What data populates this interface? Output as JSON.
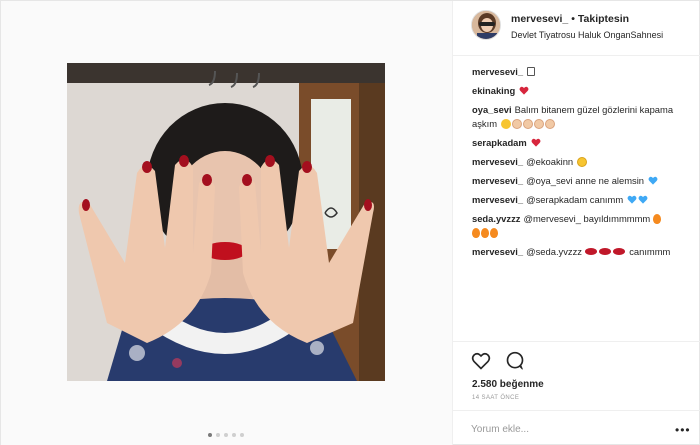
{
  "post": {
    "username": "mervesevi_",
    "separator": "•",
    "follow_status": "Takiptesin",
    "location": "Devlet Tiyatrosu Haluk OnganSahnesi",
    "carousel_count": 5,
    "carousel_active": 1
  },
  "comments": [
    {
      "user": "mervesevi_",
      "text": "",
      "emoji": "white-square"
    },
    {
      "user": "ekinaking",
      "text": "",
      "emoji": "red-heart"
    },
    {
      "user": "oya_sevi",
      "text": "Balım bitanem güzel gözlerini kapama aşkım",
      "emoji": "smile-faces"
    },
    {
      "user": "serapkadam",
      "text": "",
      "emoji": "red-heart"
    },
    {
      "user": "mervesevi_",
      "text": "@ekoakinn",
      "emoji": "laughing-face"
    },
    {
      "user": "mervesevi_",
      "text": "@oya_sevi anne ne alemsin",
      "emoji": "blue-heart"
    },
    {
      "user": "mervesevi_",
      "text": "@serapkadam canımm",
      "emoji": "blue-hearts"
    },
    {
      "user": "seda.yvzzz",
      "text": "@mervesevi_ bayıldımmmmm",
      "emoji": "fire-emojis"
    },
    {
      "user": "mervesevi_",
      "text": "@seda.yvzzz",
      "suffix": "canımmm",
      "emoji": "lips"
    }
  ],
  "actions": {
    "likes": "2.580 beğenme",
    "time": "14 SAAT ÖNCE"
  },
  "comment_box": {
    "placeholder": "Yorum ekle...",
    "more": "•••"
  },
  "colors": {
    "red_heart": "#d7263d",
    "blue_heart": "#3fa9f5",
    "fire": "#f58a1f",
    "lips": "#c0182a",
    "text": "#262626",
    "muted": "#999999"
  }
}
